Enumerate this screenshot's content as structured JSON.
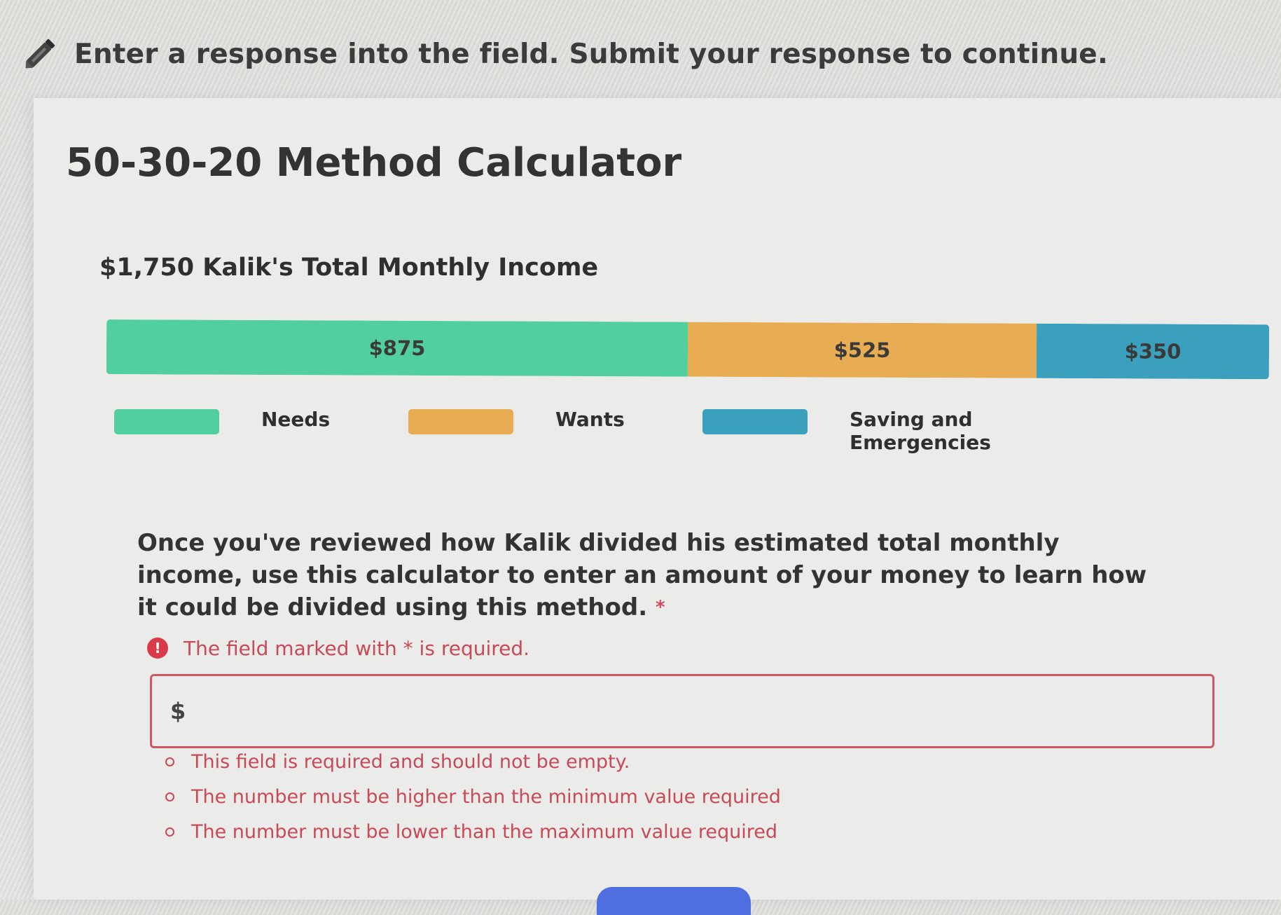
{
  "instruction": {
    "text": "Enter a response into the field. Submit your response to continue.",
    "icon": "pencil-icon"
  },
  "calculator": {
    "title": "50-30-20 Method Calculator",
    "income_label": "$1,750 Kalik's Total Monthly Income",
    "segments": [
      {
        "label": "$875",
        "share": 0.5,
        "color": "#52cf9e"
      },
      {
        "label": "$525",
        "share": 0.3,
        "color": "#e8ad52"
      },
      {
        "label": "$350",
        "share": 0.2,
        "color": "#3aa0bd"
      }
    ],
    "legend": [
      {
        "label": "Needs",
        "color": "#52cf9e"
      },
      {
        "label": "Wants",
        "color": "#e8ad52"
      },
      {
        "label": "Saving and Emergencies",
        "color": "#3aa0bd"
      }
    ]
  },
  "question": {
    "text": "Once you've reviewed how Kalik divided his estimated total monthly income, use this calculator to enter an amount of your money to learn how it could be divided using this method.",
    "required_marker": "*"
  },
  "validation": {
    "required_note": "The field marked with * is required.",
    "error_icon": "!",
    "errors": [
      "This field is required and should not be empty.",
      "The number must be higher than the minimum value required",
      "The number must be lower than the maximum value required"
    ]
  },
  "input": {
    "prefix": "$",
    "value": "",
    "placeholder": ""
  },
  "colors": {
    "error": "#c84a57",
    "submit": "#4f6fe0"
  }
}
